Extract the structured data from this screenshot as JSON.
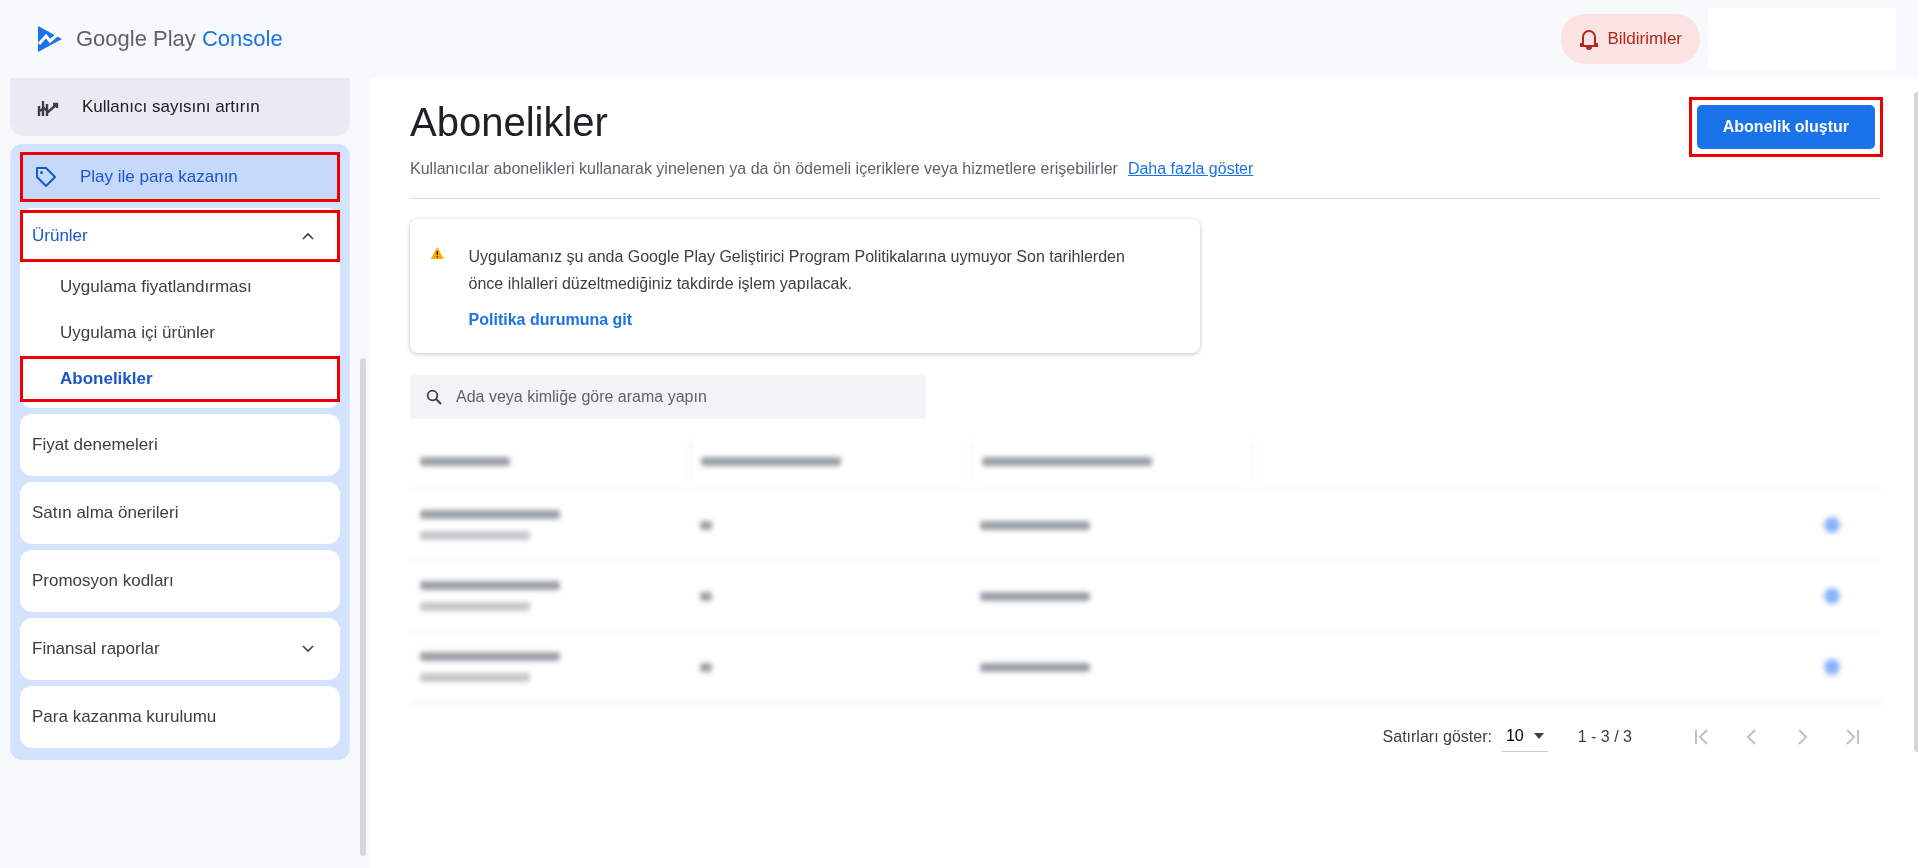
{
  "header": {
    "logo": {
      "brand": "Google Play",
      "product": "Console"
    },
    "notifications": {
      "label": "Bildirimler"
    }
  },
  "sidebar": {
    "top_item": {
      "label": "Kullanıcı sayısını artırın"
    },
    "section": {
      "label": "Play ile para kazanın",
      "selected": true,
      "highlighted": true
    },
    "items": [
      {
        "label": "Ürünler",
        "kind": "group",
        "expanded": true,
        "highlighted": true,
        "children": [
          {
            "label": "Uygulama fiyatlandırması",
            "selected": false,
            "highlighted": false
          },
          {
            "label": "Uygulama içi ürünler",
            "selected": false,
            "highlighted": false
          },
          {
            "label": "Abonelikler",
            "selected": true,
            "highlighted": true
          }
        ]
      },
      {
        "label": "Fiyat denemeleri",
        "kind": "link",
        "highlighted": false
      },
      {
        "label": "Satın alma önerileri",
        "kind": "link",
        "highlighted": false
      },
      {
        "label": "Promosyon kodları",
        "kind": "link",
        "highlighted": false
      },
      {
        "label": "Finansal raporlar",
        "kind": "group",
        "expanded": false,
        "highlighted": false
      },
      {
        "label": "Para kazanma kurulumu",
        "kind": "link",
        "highlighted": false
      }
    ]
  },
  "page": {
    "title": "Abonelikler",
    "description": "Kullanıcılar abonelikleri kullanarak yinelenen ya da ön ödemeli içeriklere veya hizmetlere erişebilirler",
    "more_link": "Daha fazla göster",
    "create_button": {
      "label": "Abonelik oluştur",
      "highlighted": true
    }
  },
  "alert": {
    "message": "Uygulamanız şu anda Google Play Geliştirici Program Politikalarına uymuyor Son tarihlerden önce ihlalleri düzeltmediğiniz takdirde işlem yapılacak.",
    "link": "Politika durumuna git"
  },
  "search": {
    "placeholder": "Ada veya kimliğe göre arama yapın"
  },
  "pagination": {
    "rows_label": "Satırları göster:",
    "rows_value": "10",
    "range": "1 - 3 / 3"
  }
}
